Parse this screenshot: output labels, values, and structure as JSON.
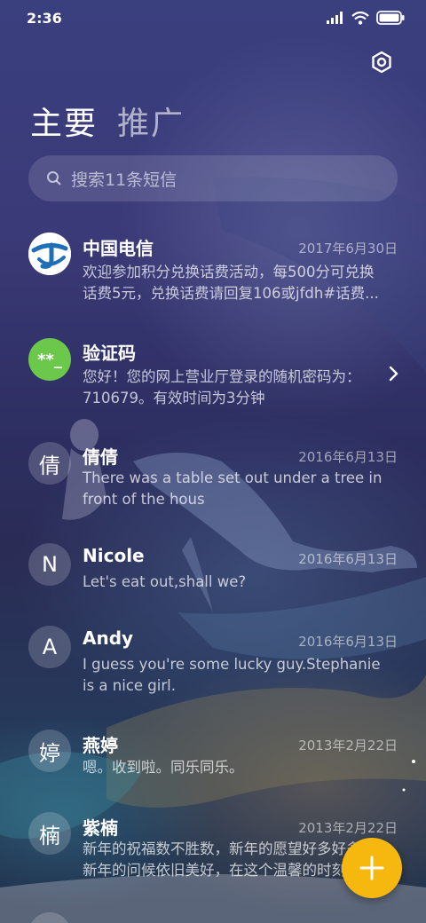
{
  "status_bar": {
    "time": "2:36"
  },
  "tabs": [
    {
      "label": "主要"
    },
    {
      "label": "推广"
    }
  ],
  "search": {
    "placeholder": "搜索11条短信"
  },
  "messages": [
    {
      "avatar": "",
      "sender": "中国电信",
      "date": "2017年6月30日",
      "preview_line1": "欢迎参加积分兑换话费活动，每500分可兑换",
      "preview_line2": "话费5元，兑换话费请回复106或jfdh#话费..."
    },
    {
      "avatar": "**_",
      "sender": "验证码",
      "date": "",
      "preview_line1": "您好！您的网上营业厅登录的随机密码为：",
      "preview_line2": "710679。有效时间为3分钟"
    },
    {
      "avatar": "倩",
      "sender": "倩倩",
      "date": "2016年6月13日",
      "preview_line1": "There was a table set out under a tree in",
      "preview_line2": "front of the hous"
    },
    {
      "avatar": "N",
      "sender": "Nicole",
      "date": "2016年6月13日",
      "preview_line1": "Let's eat out,shall we?",
      "preview_line2": ""
    },
    {
      "avatar": "A",
      "sender": "Andy",
      "date": "2016年6月13日",
      "preview_line1": "I guess you're some lucky guy.Stephanie",
      "preview_line2": "is a nice girl."
    },
    {
      "avatar": "婷",
      "sender": "燕婷",
      "date": "2013年2月22日",
      "preview_line1": "嗯。收到啦。同乐同乐。",
      "preview_line2": ""
    },
    {
      "avatar": "楠",
      "sender": "紫楠",
      "date": "2013年2月22日",
      "preview_line1": "新年的祝福数不胜数，新年的愿望好多好多，",
      "preview_line2": "新年的问候依旧美好，在这个温馨的时刻"
    }
  ],
  "colors": {
    "fab": "#f6b80f",
    "verify_avatar": "#6cc84a",
    "telecom_blue": "#1f6fb8"
  },
  "icons": {
    "settings": "gear-icon",
    "search": "search-icon",
    "compose": "plus-icon",
    "chevron": "chevron-right-icon"
  }
}
